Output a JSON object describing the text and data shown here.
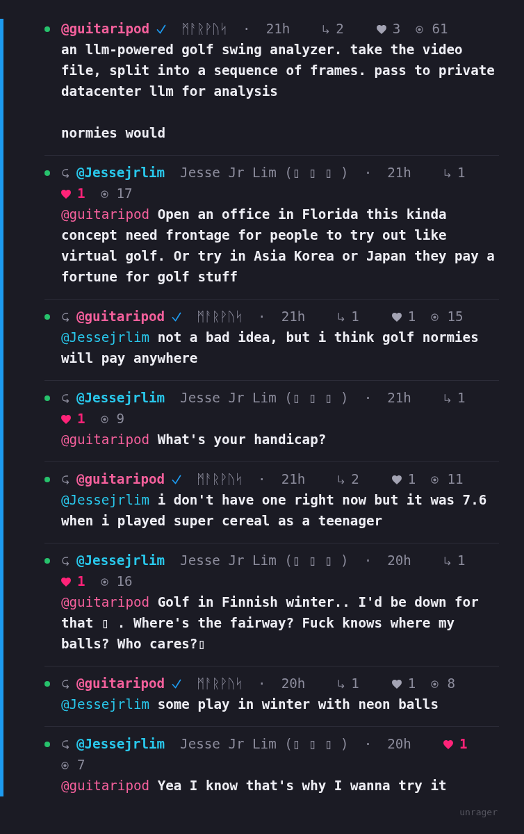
{
  "thread": {
    "selected": true,
    "posts": [
      {
        "is_reply": false,
        "handle": "@guitaripod",
        "color": "#f5609c",
        "verified": true,
        "display_name": "ᛗᚨᚱᚹᚢᛋ",
        "separator": "·",
        "time": "21h",
        "replies": "2",
        "likes": "3",
        "liked": false,
        "views": "61",
        "text": "an llm-powered golf swing analyzer. take the video file, split into a sequence of frames. pass to private datacenter llm for analysis\n\nnormies would"
      },
      {
        "is_reply": true,
        "handle": "@Jessejrlim",
        "color": "#29c8ec",
        "verified": false,
        "display_name": "Jesse Jr Lim (▯ ▯ ▯ )",
        "separator": "·",
        "time": "21h",
        "replies": "1",
        "likes": "1",
        "liked": true,
        "views": "17",
        "mention": {
          "text": "@guitaripod",
          "color": "#f5609c"
        },
        "text": "Open an office in Florida this kinda concept need frontage for people to try out like virtual golf. Or try in Asia Korea or Japan they pay a fortune for golf stuff"
      },
      {
        "is_reply": true,
        "handle": "@guitaripod",
        "color": "#f5609c",
        "verified": true,
        "display_name": "ᛗᚨᚱᚹᚢᛋ",
        "separator": "·",
        "time": "21h",
        "replies": "1",
        "likes": "1",
        "liked": false,
        "views": "15",
        "mention": {
          "text": "@Jessejrlim",
          "color": "#29c8ec"
        },
        "text": "not a bad idea, but i think golf normies will pay anywhere"
      },
      {
        "is_reply": true,
        "handle": "@Jessejrlim",
        "color": "#29c8ec",
        "verified": false,
        "display_name": "Jesse Jr Lim (▯ ▯ ▯ )",
        "separator": "·",
        "time": "21h",
        "replies": "1",
        "likes": "1",
        "liked": true,
        "views": "9",
        "mention": {
          "text": "@guitaripod",
          "color": "#f5609c"
        },
        "text": "What's your handicap?"
      },
      {
        "is_reply": true,
        "handle": "@guitaripod",
        "color": "#f5609c",
        "verified": true,
        "display_name": "ᛗᚨᚱᚹᚢᛋ",
        "separator": "·",
        "time": "21h",
        "replies": "2",
        "likes": "1",
        "liked": false,
        "views": "11",
        "mention": {
          "text": "@Jessejrlim",
          "color": "#29c8ec"
        },
        "text": "i don't have one right now but it was 7.6 when i played super cereal as a teenager"
      },
      {
        "is_reply": true,
        "handle": "@Jessejrlim",
        "color": "#29c8ec",
        "verified": false,
        "display_name": "Jesse Jr Lim (▯ ▯ ▯ )",
        "separator": "·",
        "time": "20h",
        "replies": "1",
        "likes": "1",
        "liked": true,
        "views": "16",
        "mention": {
          "text": "@guitaripod",
          "color": "#f5609c"
        },
        "text": "Golf in Finnish winter.. I'd be down for that ▯ . Where's the fairway? Fuck knows where my balls? Who cares?▯"
      },
      {
        "is_reply": true,
        "handle": "@guitaripod",
        "color": "#f5609c",
        "verified": true,
        "display_name": "ᛗᚨᚱᚹᚢᛋ",
        "separator": "·",
        "time": "20h",
        "replies": "1",
        "likes": "1",
        "liked": false,
        "views": "8",
        "mention": {
          "text": "@Jessejrlim",
          "color": "#29c8ec"
        },
        "text": "some play in winter with neon balls"
      },
      {
        "is_reply": true,
        "handle": "@Jessejrlim",
        "color": "#29c8ec",
        "verified": false,
        "display_name": "Jesse Jr Lim (▯ ▯ ▯ )",
        "separator": "·",
        "time": "20h",
        "likes": "1",
        "liked": true,
        "views": "7",
        "mention": {
          "text": "@guitaripod",
          "color": "#f5609c"
        },
        "text": "Yea I know that's why I wanna try it"
      }
    ]
  },
  "footer": {
    "app_name": "unrager"
  }
}
